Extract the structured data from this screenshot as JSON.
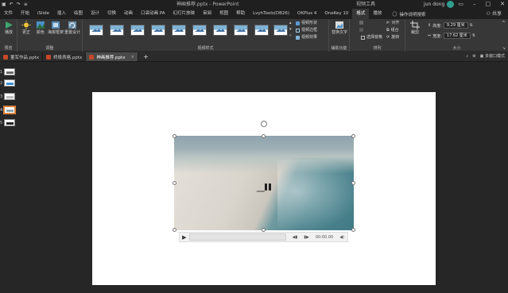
{
  "titlebar": {
    "doc_title": "神画推荐.pptx  -  PowerPoint",
    "context_title": "视频工具",
    "user_name": "jun dong"
  },
  "tabs": [
    {
      "label": "文件"
    },
    {
      "label": "开始"
    },
    {
      "label": "iSlide"
    },
    {
      "label": "插入"
    },
    {
      "label": "绘图"
    },
    {
      "label": "设计"
    },
    {
      "label": "切换"
    },
    {
      "label": "动画"
    },
    {
      "label": "口袋动画 PA"
    },
    {
      "label": "幻灯片放映"
    },
    {
      "label": "审阅"
    },
    {
      "label": "视图"
    },
    {
      "label": "帮助"
    },
    {
      "label": "LvyhTools(DB26)"
    },
    {
      "label": "OKPlus 4"
    },
    {
      "label": "OneKey 10"
    },
    {
      "label": "格式"
    },
    {
      "label": "播放"
    }
  ],
  "tell_me": "操作说明搜索",
  "share": "共享",
  "ribbon": {
    "preview": {
      "button": "播放",
      "group": "预览"
    },
    "adjust": {
      "buttons": [
        "更正",
        "颜色",
        "海报框架",
        "重置设计"
      ],
      "group": "调整"
    },
    "styles": {
      "group": "视频样式",
      "options": [
        "视频形状",
        "视频边框",
        "视频效果"
      ]
    },
    "accessibility": {
      "button": "替换文字",
      "group": "辅助功能"
    },
    "arrange": {
      "options": [
        "选择窗格",
        "对齐",
        "组合",
        "旋转"
      ],
      "group": "排列"
    },
    "crop": {
      "button": "裁剪"
    },
    "size": {
      "height_label": "高度:",
      "height_value": "9.29 厘米",
      "width_label": "宽度:",
      "width_value": "17.62 厘米",
      "group": "大小"
    }
  },
  "doc_tabs": [
    {
      "label": "董军作品.pptx"
    },
    {
      "label": "终极表格.pptx"
    },
    {
      "label": "神画推荐.pptx"
    }
  ],
  "doc_right": {
    "label": "多窗口模式"
  },
  "slides": [
    "1",
    "2",
    "3",
    "4",
    "5"
  ],
  "video": {
    "time": "00:00.00"
  },
  "colors": {
    "accent": "#d9823b",
    "ribbon": "#373737",
    "titlebar": "#1f1f1f"
  }
}
